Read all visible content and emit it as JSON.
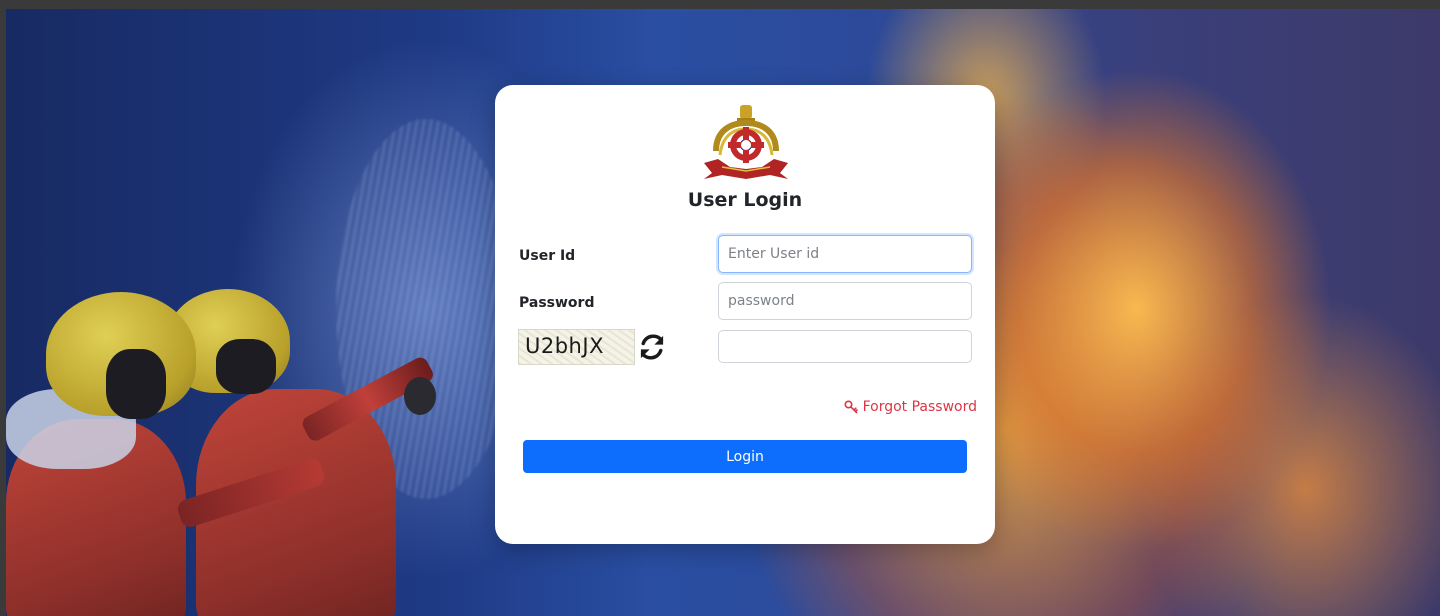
{
  "page": {
    "title": "User Login",
    "accent_color": "#0d6efd",
    "link_color": "#dc3545"
  },
  "form": {
    "user_id": {
      "label": "User Id",
      "placeholder": "Enter User id",
      "value": ""
    },
    "password": {
      "label": "Password",
      "placeholder": "password",
      "value": ""
    },
    "captcha": {
      "code": "U2bhJX",
      "input_value": "",
      "refresh_icon": "refresh-icon"
    },
    "forgot_password": {
      "label": "Forgot Password",
      "icon": "key-icon"
    },
    "submit_label": "Login"
  },
  "icons": {
    "emblem": "police-emblem"
  }
}
